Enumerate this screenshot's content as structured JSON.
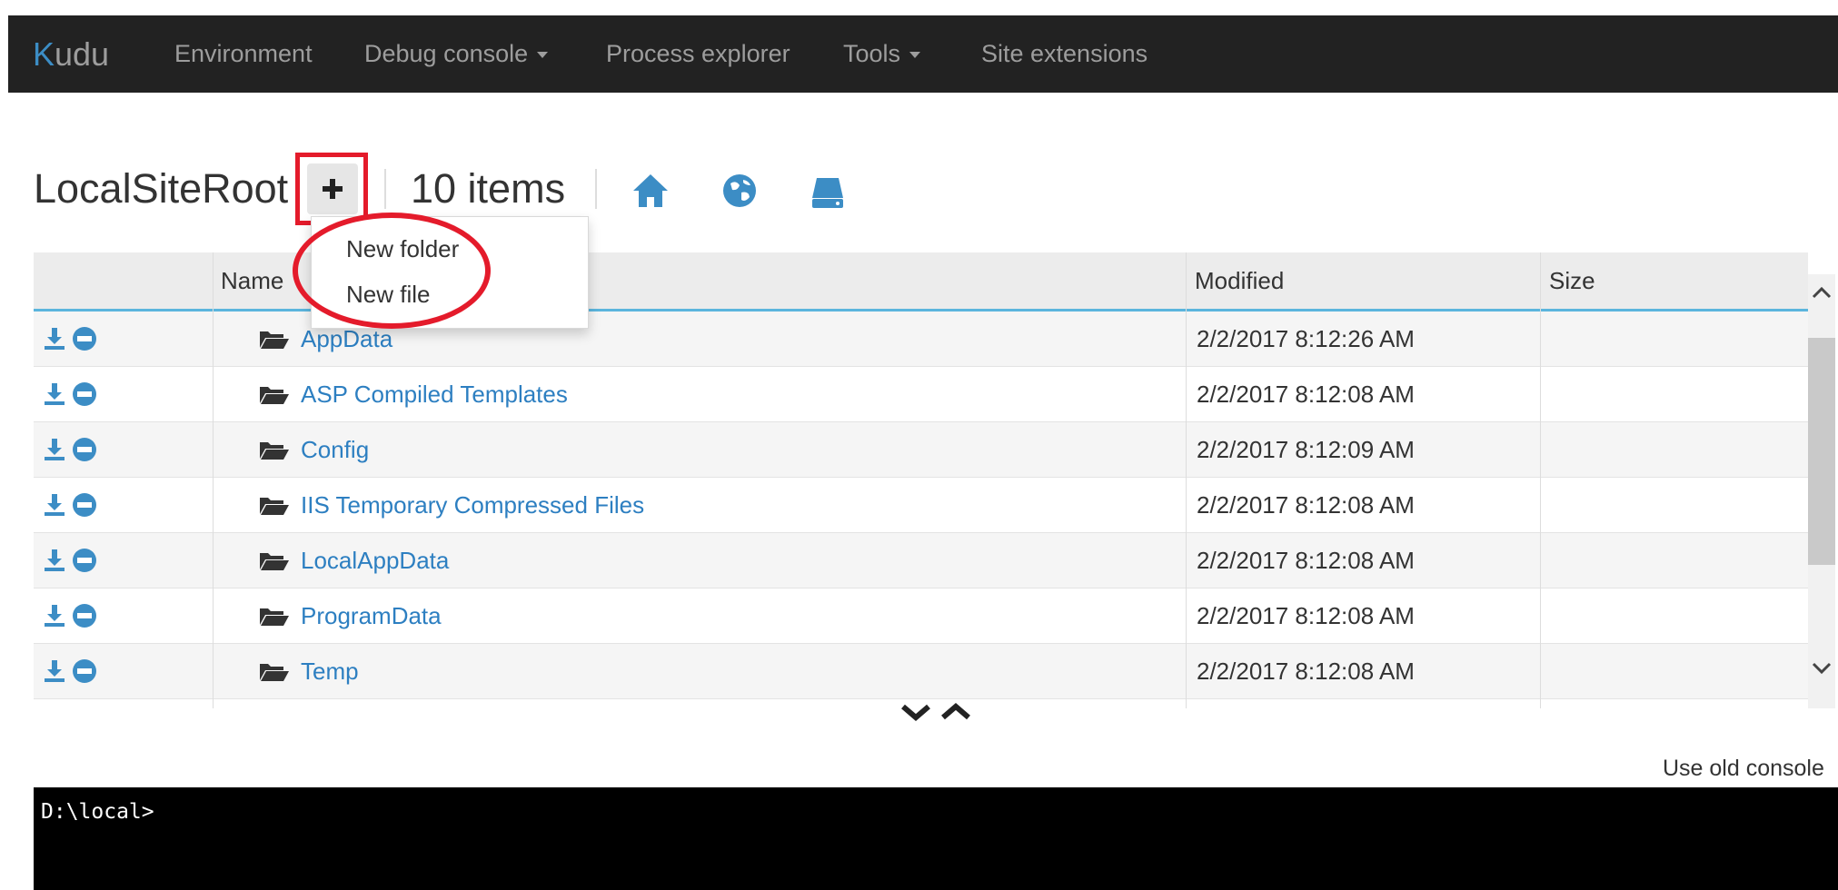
{
  "navbar": {
    "brand_k": "K",
    "brand_rest": "udu",
    "items": [
      {
        "label": "Environment",
        "dropdown": false
      },
      {
        "label": "Debug console",
        "dropdown": true
      },
      {
        "label": "Process explorer",
        "dropdown": false
      },
      {
        "label": "Tools",
        "dropdown": true
      },
      {
        "label": "Site extensions",
        "dropdown": false
      }
    ]
  },
  "header": {
    "title": "LocalSiteRoot",
    "item_count": "10 items",
    "icons": [
      "plus-icon",
      "home-icon",
      "globe-icon",
      "drive-icon"
    ]
  },
  "dropdown_menu": {
    "items": [
      "New folder",
      "New file"
    ]
  },
  "table": {
    "columns": [
      "Name",
      "Modified",
      "Size"
    ],
    "rows": [
      {
        "name": "AppData",
        "modified": "2/2/2017 8:12:26 AM",
        "size": ""
      },
      {
        "name": "ASP Compiled Templates",
        "modified": "2/2/2017 8:12:08 AM",
        "size": ""
      },
      {
        "name": "Config",
        "modified": "2/2/2017 8:12:09 AM",
        "size": ""
      },
      {
        "name": "IIS Temporary Compressed Files",
        "modified": "2/2/2017 8:12:08 AM",
        "size": ""
      },
      {
        "name": "LocalAppData",
        "modified": "2/2/2017 8:12:08 AM",
        "size": ""
      },
      {
        "name": "ProgramData",
        "modified": "2/2/2017 8:12:08 AM",
        "size": ""
      },
      {
        "name": "Temp",
        "modified": "2/2/2017 8:12:08 AM",
        "size": ""
      }
    ]
  },
  "console": {
    "old_console_link": "Use old console",
    "prompt": "D:\\local>"
  },
  "colors": {
    "navbar_bg": "#222222",
    "accent_blue": "#3c8dc5",
    "link_blue": "#2d7fc1",
    "highlight_red": "#e41b2b",
    "header_underline": "#5bb5dd"
  }
}
